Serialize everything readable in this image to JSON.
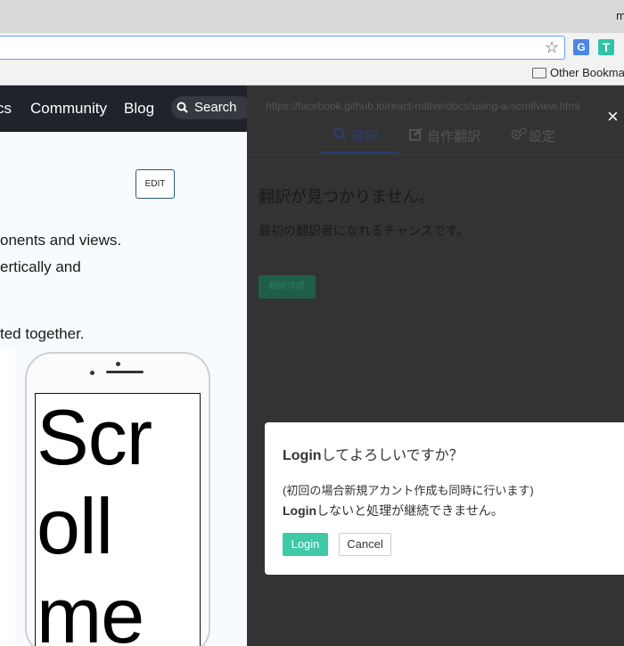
{
  "browser": {
    "user_initial": "m",
    "bookmarks_bar": {
      "other_bookmarks": "Other Bookmarks"
    },
    "star_icon": "star-icon",
    "extensions": [
      {
        "name": "translate-extension-icon",
        "glyph": "G"
      },
      {
        "name": "t-extension-icon",
        "glyph": "T"
      }
    ]
  },
  "site_nav": {
    "items": [
      "cs",
      "Community",
      "Blog"
    ],
    "search_label": "Search"
  },
  "page": {
    "edit_label": "EDIT",
    "lines": [
      "onents and views.",
      "ertically and",
      "ted together."
    ],
    "scroll_words": [
      "Scr",
      "oll",
      "me"
    ]
  },
  "translation_panel": {
    "url": "https://facebook.github.io/react-native/docs/using-a-scrollview.html",
    "close_glyph": "×",
    "tabs": [
      {
        "label": "選択",
        "icon": "search-icon"
      },
      {
        "label": "自作翻訳",
        "icon": "edit-icon"
      },
      {
        "label": "設定",
        "icon": "gears-icon"
      }
    ],
    "no_translation": "翻訳が見つかりません。",
    "first_translator": "最初の翻訳者になれるチャンスです。",
    "create_label": "翻訳作成"
  },
  "login_dialog": {
    "title_bold": "Login",
    "title_rest": "してよろしいですか？",
    "line1": "(初回の場合新規アカント作成も同時に行います)",
    "line2_bold": "Login",
    "line2_rest": "しないと処理が継続できません。",
    "login_label": "Login",
    "cancel_label": "Cancel"
  },
  "colors": {
    "nav_bg": "#20232a",
    "panel_overlay": "#333333",
    "login_accent": "#3ec9a7",
    "tab_active": "#2c3e70"
  }
}
